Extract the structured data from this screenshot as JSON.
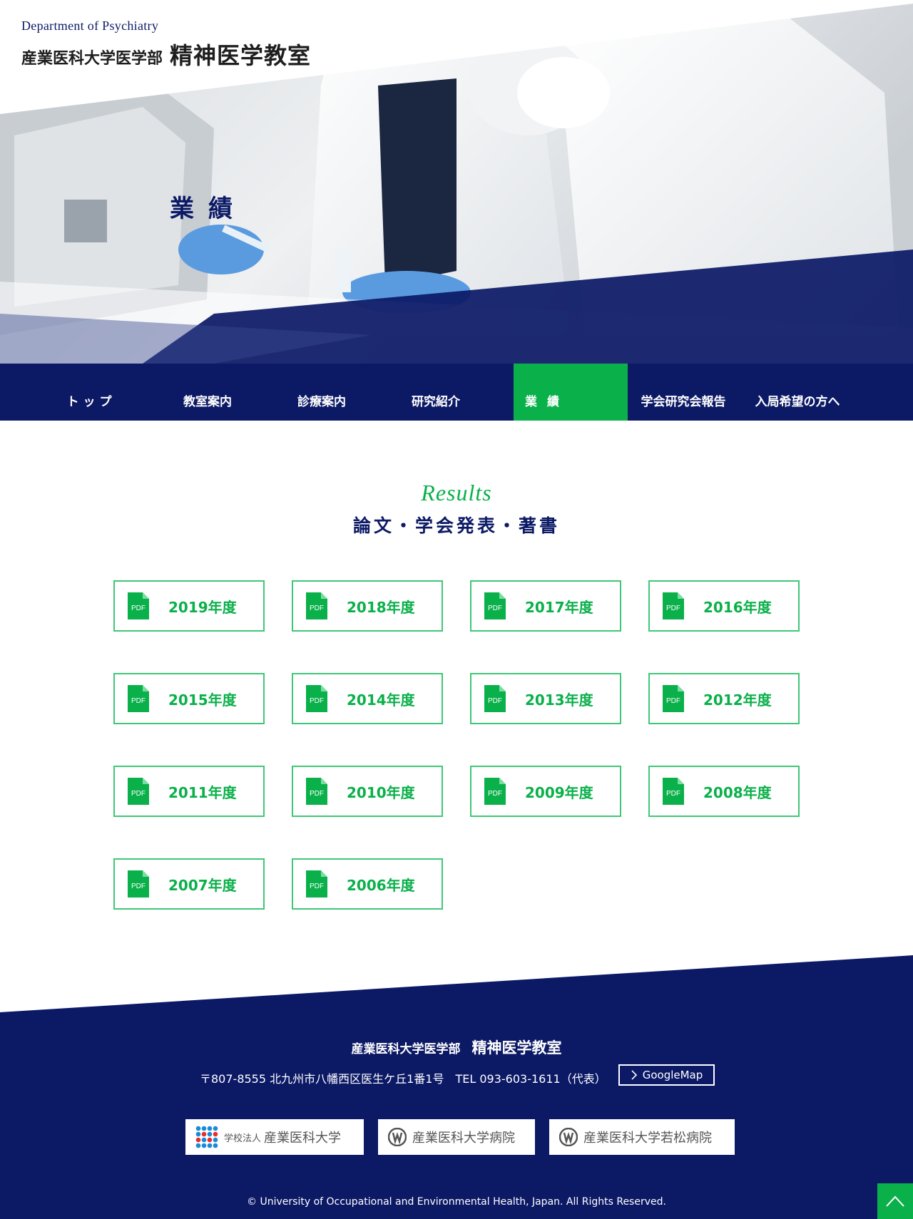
{
  "header": {
    "brand_en": "Department of Psychiatry",
    "brand_ja_sub": "産業医科大学医学部",
    "brand_ja_main": "精神医学教室",
    "hero_title": "業績"
  },
  "nav": {
    "items": [
      {
        "label": "トップ"
      },
      {
        "label": "教室案内"
      },
      {
        "label": "診療案内"
      },
      {
        "label": "研究紹介"
      },
      {
        "label": "業績",
        "active": true
      },
      {
        "label": "学会研究会報告"
      },
      {
        "label": "入局希望の方へ"
      }
    ]
  },
  "results": {
    "heading_en": "Results",
    "heading_ja": "論文・学会発表・著書",
    "pdf_icon_text": "PDF",
    "items": [
      {
        "label": "2019年度"
      },
      {
        "label": "2018年度"
      },
      {
        "label": "2017年度"
      },
      {
        "label": "2016年度"
      },
      {
        "label": "2015年度"
      },
      {
        "label": "2014年度"
      },
      {
        "label": "2013年度"
      },
      {
        "label": "2012年度"
      },
      {
        "label": "2011年度"
      },
      {
        "label": "2010年度"
      },
      {
        "label": "2009年度"
      },
      {
        "label": "2008年度"
      },
      {
        "label": "2007年度"
      },
      {
        "label": "2006年度"
      }
    ]
  },
  "footer": {
    "title_sub": "産業医科大学医学部",
    "title_main": "精神医学教室",
    "address": "〒807-8555 北九州市八幡西区医生ケ丘1番1号　TEL 093-603-1611（代表）",
    "map_label": "GoogleMap",
    "logos": [
      {
        "small": "学校法人",
        "label": "産業医科大学"
      },
      {
        "label": "産業医科大学病院"
      },
      {
        "label": "産業医科大学若松病院"
      }
    ],
    "copyright": "© University of Occupational and Environmental Health, Japan. All Rights Reserved."
  },
  "colors": {
    "navy": "#0c1a66",
    "green": "#0ab04a",
    "card_border": "#3fc777"
  },
  "icons": {
    "pdf": "pdf-file-icon",
    "map": "chevron-right-icon",
    "page_top": "chevron-up-icon"
  }
}
